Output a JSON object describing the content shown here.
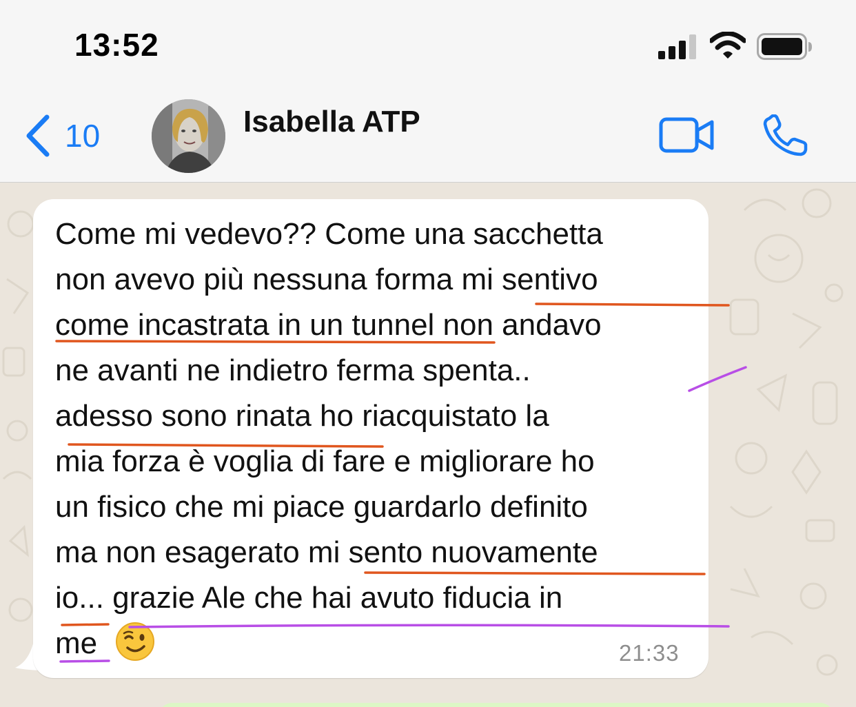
{
  "status_bar": {
    "time": "13:52"
  },
  "header": {
    "back_count": "10",
    "contact_name": "Isabella ATP",
    "icons": [
      "chevron-left-icon",
      "video-camera-icon",
      "phone-icon"
    ]
  },
  "message": {
    "lines": [
      "Come mi vedevo?? Come una sacchetta",
      "non avevo più nessuna forma mi sentivo",
      "come incastrata in un tunnel non andavo",
      "ne avanti ne indietro ferma spenta..",
      "adesso sono rinata ho riacquistato la",
      "mia forza è voglia di fare e migliorare ho",
      "un fisico che mi piace guardarlo definito",
      "ma non esagerato mi sento nuovamente",
      "io... grazie Ale che hai avuto fiducia in",
      "me"
    ],
    "emoji": "😉",
    "timestamp": "21:33"
  },
  "colors": {
    "accent": "#1a7cf5",
    "underline_orange": "#e0561e",
    "underline_purple": "#b84ee6",
    "bubble_bg": "#ffffff",
    "chat_bg": "#ebe5dc"
  }
}
